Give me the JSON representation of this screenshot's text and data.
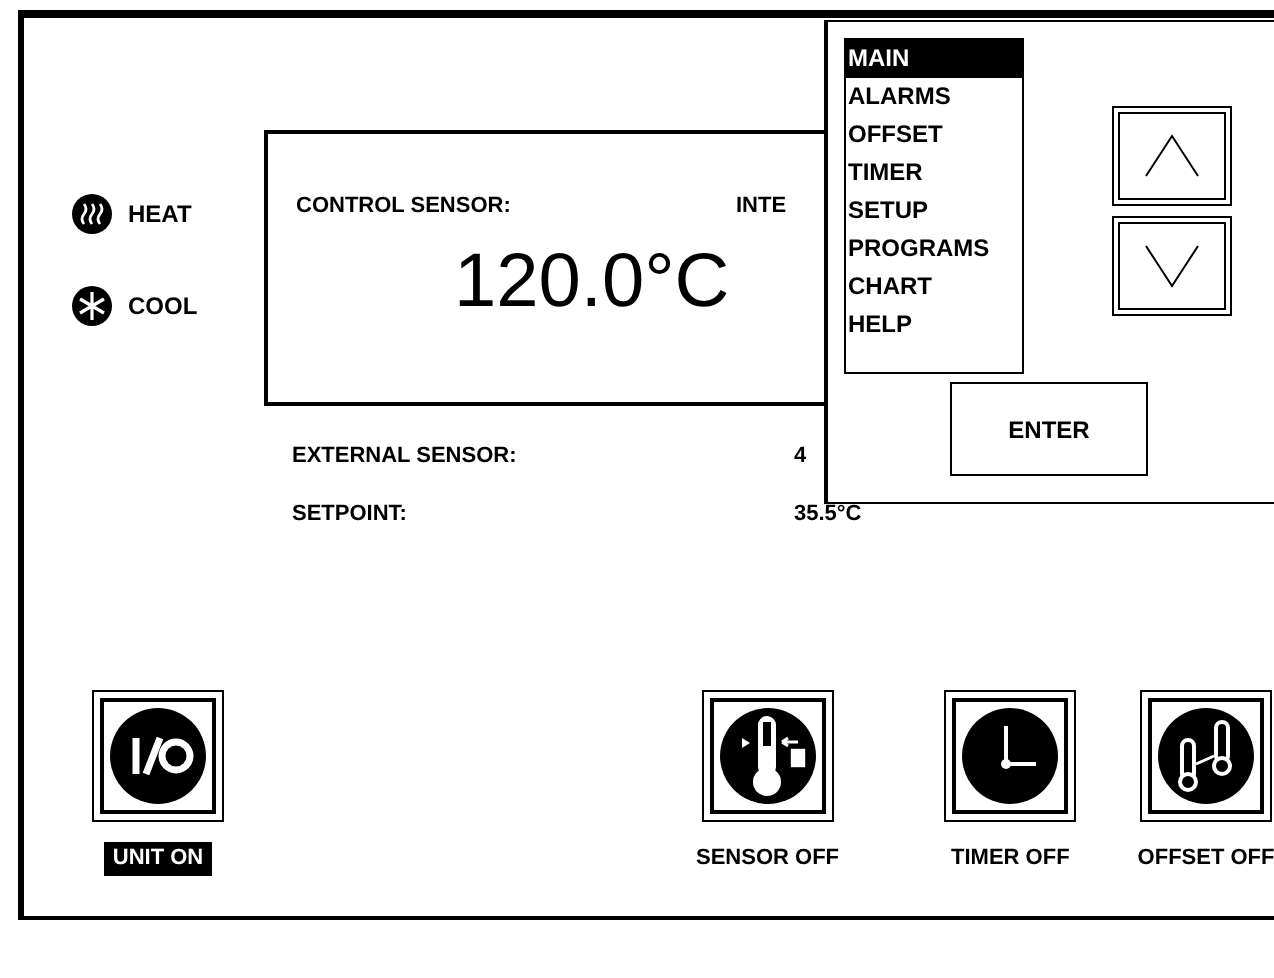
{
  "indicators": [
    {
      "kind": "heat",
      "label": "HEAT"
    },
    {
      "kind": "cool",
      "label": "COOL"
    }
  ],
  "display": {
    "label": "CONTROL SENSOR:",
    "source": "INTE",
    "value": "120.0°C"
  },
  "readings": [
    {
      "label": "EXTERNAL SENSOR:",
      "value": "4"
    },
    {
      "label": "SETPOINT:",
      "value": "35.5°C"
    }
  ],
  "controls": [
    {
      "kind": "power",
      "label": "UNIT ON",
      "on": true
    },
    {
      "kind": "sensor",
      "label": "SENSOR OFF",
      "on": false
    },
    {
      "kind": "timer",
      "label": "TIMER OFF",
      "on": false
    },
    {
      "kind": "offset",
      "label": "OFFSET OFF",
      "on": false
    }
  ],
  "menu": {
    "items": [
      {
        "label": "MAIN",
        "selected": true
      },
      {
        "label": "ALARMS",
        "selected": false
      },
      {
        "label": "OFFSET",
        "selected": false
      },
      {
        "label": "TIMER",
        "selected": false
      },
      {
        "label": "SETUP",
        "selected": false
      },
      {
        "label": "PROGRAMS",
        "selected": false
      },
      {
        "label": "CHART",
        "selected": false
      },
      {
        "label": "HELP",
        "selected": false
      }
    ],
    "enter": "ENTER"
  }
}
